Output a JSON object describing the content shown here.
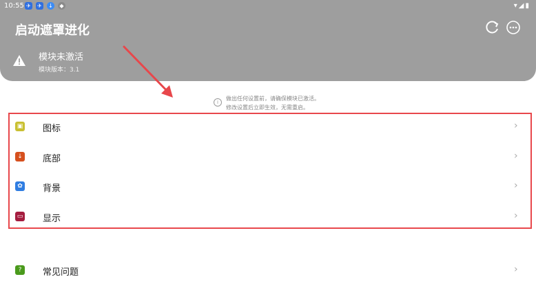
{
  "status_bar": {
    "time": "10:55",
    "notif_icons": [
      "bird-icon",
      "bird-icon",
      "download-icon",
      "shield-icon"
    ],
    "right_icons": "▾◢▮"
  },
  "header": {
    "title": "启动遮罩进化",
    "refresh_icon": "refresh-icon",
    "more_icon": "more-icon",
    "warning_title": "模块未激活",
    "warning_sub": "模块版本：3.1"
  },
  "notice": {
    "line1": "做出任何设置前，请确保模块已激活。",
    "line2": "修改设置后立即生效，无需重启。"
  },
  "settings": {
    "items": [
      {
        "label": "图标",
        "icon": "image-icon",
        "color": "#c9c032"
      },
      {
        "label": "底部",
        "icon": "download-icon",
        "color": "#d6501e"
      },
      {
        "label": "背景",
        "icon": "palette-icon",
        "color": "#2f7de1"
      },
      {
        "label": "显示",
        "icon": "display-icon",
        "color": "#a51d3f"
      }
    ],
    "faq": {
      "label": "常见问题",
      "icon": "question-icon",
      "color": "#4a9a1c"
    }
  },
  "annotation_color": "#e8474b"
}
